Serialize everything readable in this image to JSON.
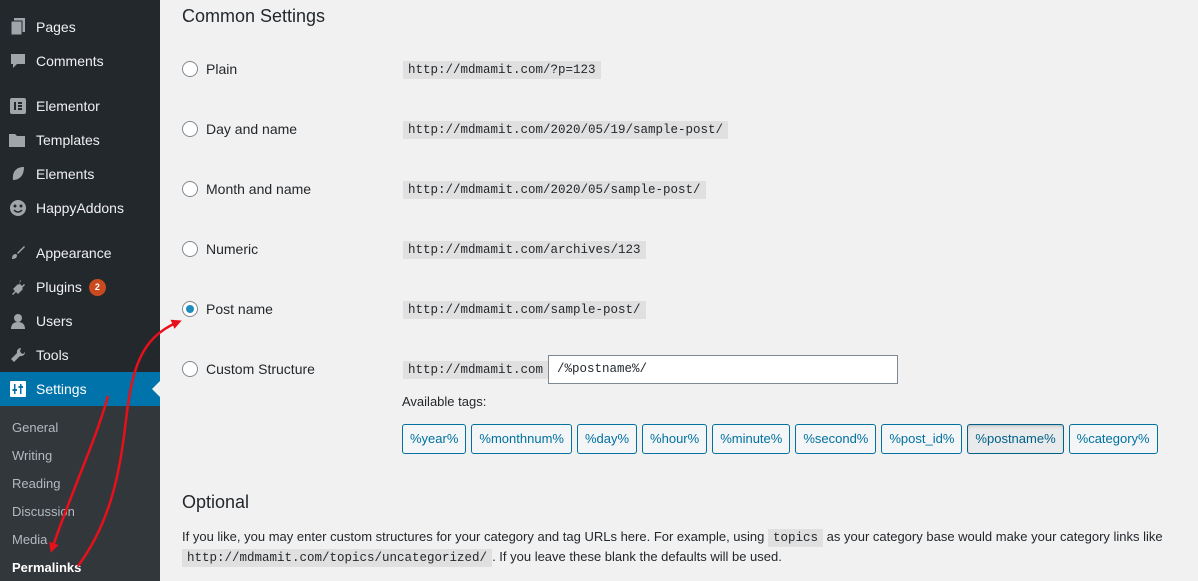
{
  "sidebar": {
    "items": [
      {
        "label": "Pages",
        "icon": "pages-icon"
      },
      {
        "label": "Comments",
        "icon": "comments-icon"
      },
      {
        "label": "Elementor",
        "icon": "elementor-icon"
      },
      {
        "label": "Templates",
        "icon": "folder-icon"
      },
      {
        "label": "Elements",
        "icon": "leaf-icon"
      },
      {
        "label": "HappyAddons",
        "icon": "happy-face-icon"
      },
      {
        "label": "Appearance",
        "icon": "paintbrush-icon"
      },
      {
        "label": "Plugins",
        "icon": "plug-icon",
        "badge": "2"
      },
      {
        "label": "Users",
        "icon": "user-icon"
      },
      {
        "label": "Tools",
        "icon": "wrench-icon"
      },
      {
        "label": "Settings",
        "icon": "settings-sliders-icon"
      }
    ],
    "submenu": [
      "General",
      "Writing",
      "Reading",
      "Discussion",
      "Media",
      "Permalinks"
    ]
  },
  "common": {
    "heading": "Common Settings",
    "options": [
      {
        "label": "Plain",
        "example": "http://mdmamit.com/?p=123",
        "checked": false
      },
      {
        "label": "Day and name",
        "example": "http://mdmamit.com/2020/05/19/sample-post/",
        "checked": false
      },
      {
        "label": "Month and name",
        "example": "http://mdmamit.com/2020/05/sample-post/",
        "checked": false
      },
      {
        "label": "Numeric",
        "example": "http://mdmamit.com/archives/123",
        "checked": false
      },
      {
        "label": "Post name",
        "example": "http://mdmamit.com/sample-post/",
        "checked": true
      },
      {
        "label": "Custom Structure",
        "example": "http://mdmamit.com",
        "checked": false
      }
    ],
    "custom_value": "/%postname%/",
    "available_tags_label": "Available tags:",
    "tags": [
      "%year%",
      "%monthnum%",
      "%day%",
      "%hour%",
      "%minute%",
      "%second%",
      "%post_id%",
      "%postname%",
      "%category%"
    ]
  },
  "optional": {
    "heading": "Optional",
    "line1_a": "If you like, you may enter custom structures for your category and tag URLs here. For example, using",
    "line1_code": "topics",
    "line1_b": "as your category base would make your category links like",
    "line2_code": "http://mdmamit.com/topics/uncategorized/",
    "line2_b": ". If you leave these blank the defaults will be used."
  },
  "colors": {
    "accent": "#0073aa",
    "arrow": "#e8101a",
    "sidebar": "#23282d"
  }
}
